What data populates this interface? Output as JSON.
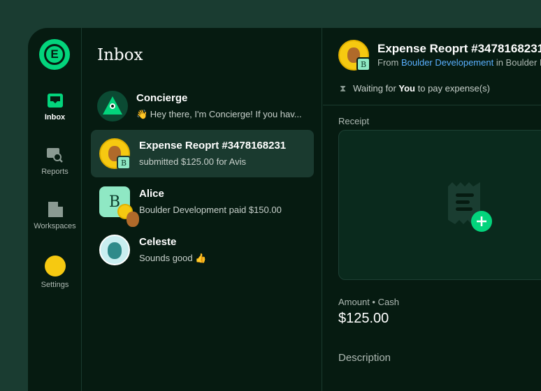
{
  "sidebar": {
    "items": [
      {
        "label": "Inbox",
        "icon": "inbox-icon",
        "active": true
      },
      {
        "label": "Reports",
        "icon": "reports-search-icon"
      },
      {
        "label": "Workspaces",
        "icon": "building-icon"
      },
      {
        "label": "Settings",
        "icon": "avatar-icon"
      }
    ]
  },
  "inbox": {
    "title": "Inbox",
    "items": [
      {
        "name": "Concierge",
        "preview": "👋 Hey there, I'm Concierge! If you hav..."
      },
      {
        "name": "Expense Reoprt #3478168231",
        "preview": "submitted $125.00 for Avis",
        "badge": "B",
        "selected": true
      },
      {
        "name": "Alice",
        "preview": "Boulder Development paid $150.00",
        "avatar_letter": "B"
      },
      {
        "name": "Celeste",
        "preview": "Sounds good 👍"
      }
    ]
  },
  "report": {
    "title": "Expense Reoprt #3478168231",
    "from_prefix": "From ",
    "from_link": "Boulder Developement",
    "from_suffix": " in Boulder Development",
    "badge": "B",
    "status_prefix": "Waiting for ",
    "status_bold": "You",
    "status_suffix": " to pay expense(s)",
    "receipt_label": "Receipt",
    "amount_label": "Amount • Cash",
    "amount": "$125.00",
    "description_label": "Description"
  },
  "colors": {
    "accent": "#03d47c",
    "link": "#5ab0ff",
    "background": "#061b11"
  }
}
